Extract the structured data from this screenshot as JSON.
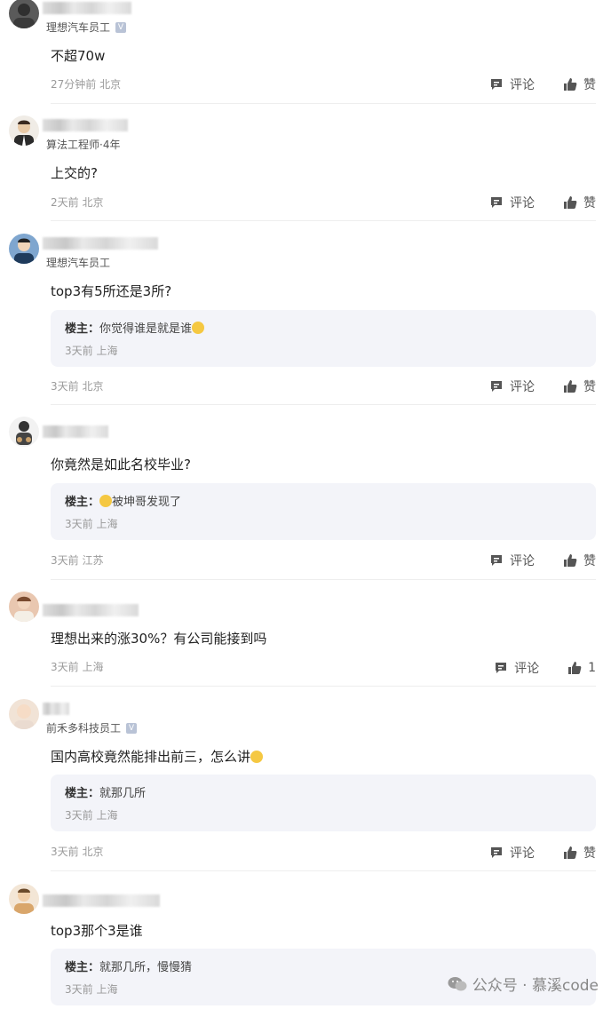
{
  "action_labels": {
    "comment": "评论",
    "like": "赞"
  },
  "reply_author_prefix": "楼主：",
  "comments": [
    {
      "subtitle": "理想汽车员工",
      "verified": true,
      "text": "不超70w",
      "meta": "27分钟前 北京",
      "like": "赞"
    },
    {
      "subtitle": "算法工程师·4年",
      "verified": false,
      "text": "上交的?",
      "meta": "2天前 北京",
      "like": "赞"
    },
    {
      "subtitle": "理想汽车员工",
      "verified": false,
      "text": "top3有5所还是3所?",
      "meta": "3天前 北京",
      "like": "赞",
      "reply": {
        "text": "你觉得谁是就是谁",
        "meta": "3天前 上海"
      }
    },
    {
      "subtitle": "",
      "verified": false,
      "text": "你竟然是如此名校毕业?",
      "meta": "3天前 江苏",
      "like": "赞",
      "reply": {
        "text": "被坤哥发现了",
        "meta": "3天前 上海"
      }
    },
    {
      "subtitle": "",
      "verified": false,
      "text": "理想出来的涨30%？有公司能接到吗",
      "meta": "3天前 上海",
      "like": "1"
    },
    {
      "subtitle": "前禾多科技员工",
      "verified": true,
      "text": "国内高校竟然能排出前三，怎么讲",
      "meta": "3天前 北京",
      "like": "赞",
      "reply": {
        "text": "就那几所",
        "meta": "3天前 上海"
      }
    },
    {
      "subtitle": "",
      "verified": false,
      "text": "top3那个3是谁",
      "meta": "",
      "like": "",
      "reply": {
        "text": "就那几所，慢慢猜",
        "meta": "3天前 上海"
      }
    }
  ],
  "watermark": {
    "text": "公众号 · 慕溪code"
  }
}
